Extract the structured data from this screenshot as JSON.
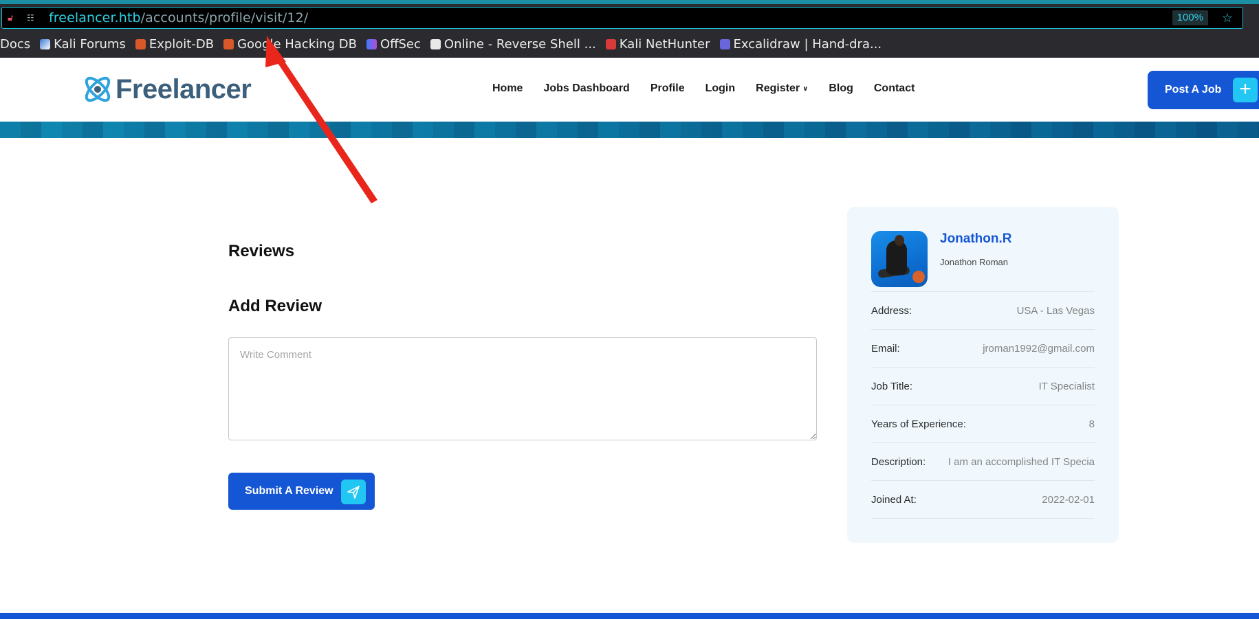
{
  "browser": {
    "url_host": "freelancer.htb",
    "url_path": "/accounts/profile/visit/12/",
    "zoom": "100%",
    "bookmarks": [
      {
        "label": "Docs",
        "icon": "none"
      },
      {
        "label": "Kali Forums",
        "icon": "kali-icon"
      },
      {
        "label": "Exploit-DB",
        "icon": "exploitdb-icon"
      },
      {
        "label": "Google Hacking DB",
        "icon": "exploitdb-icon"
      },
      {
        "label": "OffSec",
        "icon": "offsec-icon"
      },
      {
        "label": "Online - Reverse Shell ...",
        "icon": "skull-icon"
      },
      {
        "label": "Kali NetHunter",
        "icon": "nethunter-icon"
      },
      {
        "label": "Excalidraw | Hand-dra...",
        "icon": "excalidraw-icon"
      }
    ]
  },
  "site": {
    "logo_text": "Freelancer",
    "nav": {
      "home": "Home",
      "jobs": "Jobs Dashboard",
      "profile": "Profile",
      "login": "Login",
      "register": "Register",
      "blog": "Blog",
      "contact": "Contact"
    },
    "post_job": "Post A Job",
    "colors": {
      "primary": "#1556d4",
      "accent": "#22c6f2",
      "logo": "#3c5f7c"
    }
  },
  "main": {
    "reviews_title": "Reviews",
    "add_review_title": "Add Review",
    "comment_placeholder": "Write Comment",
    "submit_label": "Submit A Review"
  },
  "profile": {
    "username": "Jonathon.R",
    "full_name": "Jonathon Roman",
    "rows": [
      {
        "key": "Address:",
        "value": "USA - Las Vegas"
      },
      {
        "key": "Email:",
        "value": "jroman1992@gmail.com"
      },
      {
        "key": "Job Title:",
        "value": "IT Specialist"
      },
      {
        "key": "Years of Experience:",
        "value": "8"
      },
      {
        "key": "Description:",
        "value": "I am an accomplished IT Specia"
      },
      {
        "key": "Joined At:",
        "value": "2022-02-01"
      }
    ]
  }
}
